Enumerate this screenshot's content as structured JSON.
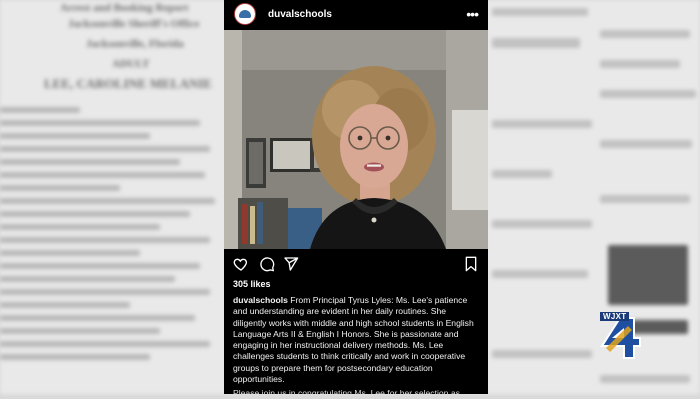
{
  "background_doc": {
    "line1": "Arrest and Booking Report",
    "line2": "Jacksonville Sheriff's Office",
    "line3": "Jacksonville, Florida",
    "line4": "ADULT",
    "line5": "LEE, CAROLINE MELANIE"
  },
  "post": {
    "username": "duvalschools",
    "likes": "305 likes",
    "caption_user": "duvalschools",
    "caption_text": " From Principal Tyrus Lyles: Ms. Lee's patience and understanding are evident in her daily routines. She diligently works with middle and high school students in English Language Arts II & English I Honors. She is passionate and engaging in her instructional delivery methods. Ms. Lee challenges students to think critically and work in cooperative groups to prepare them for postsecondary education opportunities.",
    "caption_more": "Please join us in congratulating Ms. Lee for her selection as"
  },
  "station_logo": {
    "text": "WJXT",
    "number": "4"
  },
  "icons": [
    "heart-icon",
    "comment-icon",
    "share-icon",
    "bookmark-icon",
    "more-icon"
  ]
}
